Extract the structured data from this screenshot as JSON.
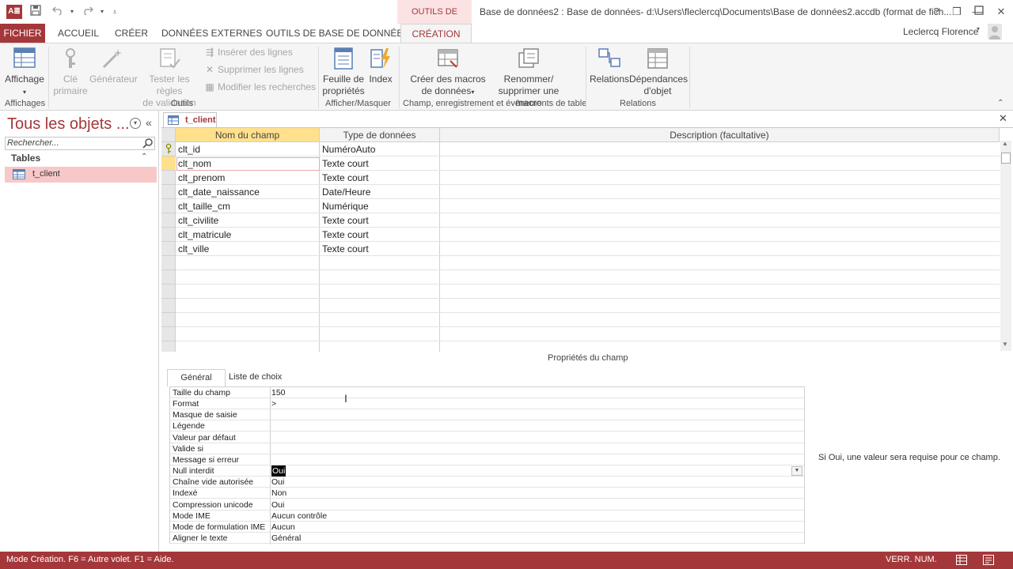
{
  "titlebar": {
    "app_icon": "A≣",
    "context_label": "OUTILS DE TABLE",
    "window_title": "Base de données2 : Base de données- d:\\Users\\fleclercq\\Documents\\Base de données2.accdb (format de fich...",
    "help": "?",
    "restore": "❒",
    "minimize": "—",
    "maximize": "☐",
    "close": "✕"
  },
  "tabs": {
    "file": "FICHIER",
    "items": [
      "ACCUEIL",
      "CRÉER",
      "DONNÉES EXTERNES",
      "OUTILS DE BASE DE DONNÉES"
    ],
    "active": "CRÉATION",
    "user": "Leclercq Florence"
  },
  "ribbon": {
    "affichage": "Affichage",
    "cle_primaire_1": "Clé",
    "cle_primaire_2": "primaire",
    "generateur": "Générateur",
    "tester_1": "Tester les règles",
    "tester_2": "de validation",
    "inserer": "Insérer des lignes",
    "supprimer": "Supprimer les lignes",
    "modifier": "Modifier les recherches",
    "feuille_1": "Feuille de",
    "feuille_2": "propriétés",
    "index": "Index",
    "creer_macros_1": "Créer des macros",
    "creer_macros_2": "de données",
    "renommer_1": "Renommer/",
    "renommer_2": "supprimer une macro",
    "relations": "Relations",
    "dependances_1": "Dépendances",
    "dependances_2": "d'objet",
    "groups": {
      "affichages": "Affichages",
      "outils": "Outils",
      "afficher_masquer": "Afficher/Masquer",
      "champ": "Champ, enregistrement et événements de table",
      "relations": "Relations"
    },
    "colors": {
      "accent": "#a4373a",
      "disabled": "#a6a6a6"
    }
  },
  "nav": {
    "title": "Tous les objets ...",
    "search_placeholder": "Rechercher...",
    "section": "Tables",
    "items": [
      {
        "label": "t_client"
      }
    ]
  },
  "doc": {
    "tab_label": "t_client",
    "close": "✕",
    "headers": {
      "field_name": "Nom du champ",
      "data_type": "Type de données",
      "description": "Description (facultative)"
    },
    "rows": [
      {
        "name": "clt_id",
        "type": "NuméroAuto",
        "primary_key": true
      },
      {
        "name": "clt_nom",
        "type": "Texte court"
      },
      {
        "name": "clt_prenom",
        "type": "Texte court"
      },
      {
        "name": "clt_date_naissance",
        "type": "Date/Heure"
      },
      {
        "name": "clt_taille_cm",
        "type": "Numérique"
      },
      {
        "name": "clt_civilite",
        "type": "Texte court"
      },
      {
        "name": "clt_matricule",
        "type": "Texte court"
      },
      {
        "name": "clt_ville",
        "type": "Texte court"
      }
    ]
  },
  "props": {
    "title": "Propriétés du champ",
    "tab_general": "Général",
    "tab_lookup": "Liste de choix",
    "rows": [
      {
        "label": "Taille du champ",
        "value": "150"
      },
      {
        "label": "Format",
        "value": ">"
      },
      {
        "label": "Masque de saisie",
        "value": ""
      },
      {
        "label": "Légende",
        "value": ""
      },
      {
        "label": "Valeur par défaut",
        "value": ""
      },
      {
        "label": "Valide si",
        "value": ""
      },
      {
        "label": "Message si erreur",
        "value": ""
      },
      {
        "label": "Null interdit",
        "value": "Oui"
      },
      {
        "label": "Chaîne vide autorisée",
        "value": "Oui"
      },
      {
        "label": "Indexé",
        "value": "Non"
      },
      {
        "label": "Compression unicode",
        "value": "Oui"
      },
      {
        "label": "Mode IME",
        "value": "Aucun contrôle"
      },
      {
        "label": "Mode de formulation IME",
        "value": "Aucun"
      },
      {
        "label": "Aligner le texte",
        "value": "Général"
      }
    ],
    "hint": "Si Oui, une valeur sera requise pour ce champ."
  },
  "status": {
    "text": "Mode Création. F6 = Autre volet. F1 = Aide.",
    "num": "VERR. NUM."
  }
}
